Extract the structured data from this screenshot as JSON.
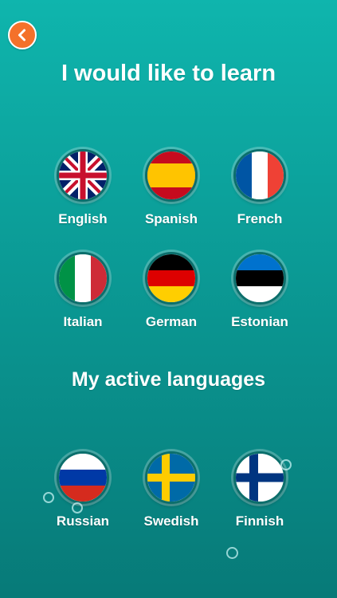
{
  "header": {
    "back_icon": "chevron-left-icon"
  },
  "learn": {
    "title": "I would like to learn",
    "languages": [
      {
        "label": "English",
        "flag": "uk-flag-icon"
      },
      {
        "label": "Spanish",
        "flag": "spain-flag-icon"
      },
      {
        "label": "French",
        "flag": "france-flag-icon"
      },
      {
        "label": "Italian",
        "flag": "italy-flag-icon"
      },
      {
        "label": "German",
        "flag": "germany-flag-icon"
      },
      {
        "label": "Estonian",
        "flag": "estonia-flag-icon"
      }
    ]
  },
  "active": {
    "title": "My active languages",
    "languages": [
      {
        "label": "Russian",
        "flag": "russia-flag-icon"
      },
      {
        "label": "Swedish",
        "flag": "sweden-flag-icon"
      },
      {
        "label": "Finnish",
        "flag": "finland-flag-icon"
      }
    ]
  },
  "colors": {
    "background": "#0fb5ad",
    "back_button": "#f4712a"
  }
}
